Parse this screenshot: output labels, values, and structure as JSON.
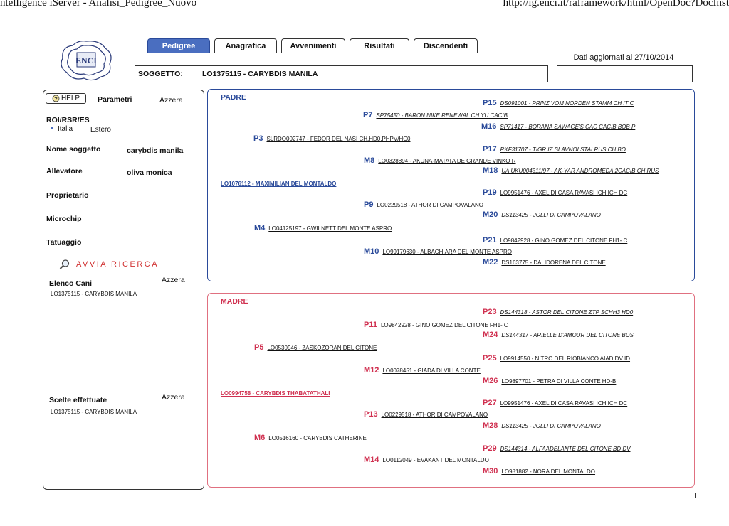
{
  "window": {
    "title": "ntelligence iServer - Analisi_Pedigree_Nuovo",
    "url": "http://ig.enci.it/raframework/html/OpenDoc?DocInst"
  },
  "tabs": [
    {
      "label": "Pedigree",
      "active": true
    },
    {
      "label": "Anagrafica",
      "active": false
    },
    {
      "label": "Avvenimenti",
      "active": false
    },
    {
      "label": "Risultati",
      "active": false
    },
    {
      "label": "Discendenti",
      "active": false
    }
  ],
  "updated_label": "Dati aggiornati al 27/10/2014",
  "subject": {
    "label": "SOGGETTO:",
    "value": "LO1375115 - CARYBDIS MANILA"
  },
  "logo": {
    "text": "ENCI"
  },
  "left": {
    "help_label": "HELP",
    "params_label": "Parametri",
    "reset_label": "Azzera",
    "roi_label": "ROI/RSR/ES",
    "radio_italia": "Italia",
    "radio_estero": "Estero",
    "name_label": "Nome soggetto",
    "name_value": "carybdis manila",
    "breeder_label": "Allevatore",
    "breeder_value": "oliva monica",
    "owner_label": "Proprietario",
    "microchip_label": "Microchip",
    "tattoo_label": "Tatuaggio",
    "search_label": "AVVIA RICERCA",
    "dogs_label": "Elenco Cani",
    "dogs_reset": "Azzera",
    "dogs_item": "LO1375115 - CARYBDIS MANILA",
    "choices_label": "Scelte effettuate",
    "choices_reset": "Azzera",
    "choices_item": "LO1375115 - CARYBDIS MANILA"
  },
  "padre": {
    "title": "PADRE",
    "root": "LO1076112 - MAXIMILIAN DEL MONTALDO",
    "ancestors": [
      {
        "code": "P15",
        "name": "DS091001 - PRINZ VOM NORDEN STAMM CH IT C"
      },
      {
        "code": "P7",
        "name": "SP75450 - BARON NIKE RENEWAL CH YU CACIB"
      },
      {
        "code": "M16",
        "name": "SP71417 - BORANA SAWAGE'S CAC CACIB BOB P"
      },
      {
        "code": "P3",
        "name": "SLRDO002747 - FEDOR DEL NASI CH,HD0,PHPV/HC0"
      },
      {
        "code": "P17",
        "name": "RKF31707 - TIGR IZ SLAVNOI STAI RUS CH BO"
      },
      {
        "code": "M8",
        "name": "LO0328894 - AKUNA-MATATA DE GRANDE VINKO R"
      },
      {
        "code": "M18",
        "name": "UA UKU004311/97 - AK-YAR ANDROMEDA 2CACIB CH RUS"
      },
      {
        "code": "P19",
        "name": "LO9951476 - AXEL DI CASA RAVASI ICH ICH DC"
      },
      {
        "code": "P9",
        "name": "LO0229518 - ATHOR DI CAMPOVALANO"
      },
      {
        "code": "M20",
        "name": "DS113425 - JOLLI DI CAMPOVALANO"
      },
      {
        "code": "M4",
        "name": "LO04125197 - GWILNETT DEL MONTE ASPRO"
      },
      {
        "code": "P21",
        "name": "LO9842928 - GINO GOMEZ DEL CITONE FH1- C"
      },
      {
        "code": "M10",
        "name": "LO99179630 - ALBACHIARA DEL MONTE ASPRO"
      },
      {
        "code": "M22",
        "name": "DS163775 - DALIDORENA DEL CITONE"
      }
    ]
  },
  "madre": {
    "title": "MADRE",
    "root": "LO0994758 - CARYBDIS THABATATHALI",
    "ancestors": [
      {
        "code": "P23",
        "name": "DS144318 - ASTOR DEL CITONE ZTP SCHH3 HD0"
      },
      {
        "code": "P11",
        "name": "LO9842928 - GINO GOMEZ DEL CITONE FH1- C"
      },
      {
        "code": "M24",
        "name": "DS144317 - ARIELLE D'AMOUR DEL CITONE BDS"
      },
      {
        "code": "P5",
        "name": "LO0530946 - ZASKOZORAN DEL CITONE"
      },
      {
        "code": "P25",
        "name": "LO9914550 - NITRO DEL RIOBIANCO AIAD DV ID"
      },
      {
        "code": "M12",
        "name": "LO0078451 - GIADA DI VILLA CONTE"
      },
      {
        "code": "M26",
        "name": "LO9897701 - PETRA DI VILLA CONTE HD-B"
      },
      {
        "code": "P27",
        "name": "LO9951476 - AXEL DI CASA RAVASI ICH ICH DC"
      },
      {
        "code": "P13",
        "name": "LO0229518 - ATHOR DI CAMPOVALANO"
      },
      {
        "code": "M28",
        "name": "DS113425 - JOLLI DI CAMPOVALANO"
      },
      {
        "code": "M6",
        "name": "LO0516160 - CARYBDIS CATHERINE"
      },
      {
        "code": "P29",
        "name": "DS144314 - ALFAADELANTE DEL CITONE BD DV"
      },
      {
        "code": "M14",
        "name": "LO0112049 - EVAKANT DEL MONTALDO"
      },
      {
        "code": "M30",
        "name": "LO981882 - NORA DEL MONTALDO"
      }
    ]
  },
  "colors": {
    "padre": "#2a4a9a",
    "madre": "#d03050",
    "tab_active": "#4a6ec0",
    "search_link": "#d03030"
  }
}
